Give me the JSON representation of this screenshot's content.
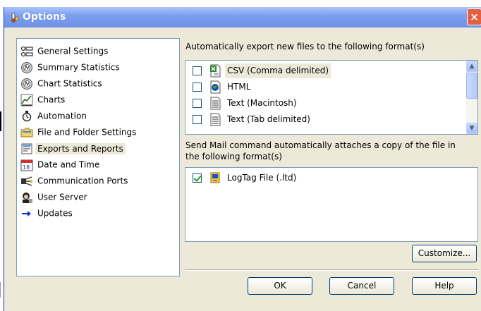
{
  "window": {
    "title": "Options",
    "close_glyph": "×"
  },
  "sidebar": {
    "items": [
      {
        "label": "General Settings",
        "icon": "general-settings-icon"
      },
      {
        "label": "Summary Statistics",
        "icon": "summary-statistics-icon"
      },
      {
        "label": "Chart Statistics",
        "icon": "chart-statistics-icon"
      },
      {
        "label": "Charts",
        "icon": "charts-icon"
      },
      {
        "label": "Automation",
        "icon": "automation-icon"
      },
      {
        "label": "File and Folder Settings",
        "icon": "folder-icon"
      },
      {
        "label": "Exports and Reports",
        "icon": "exports-icon",
        "selected": true
      },
      {
        "label": "Date and Time",
        "icon": "calendar-icon"
      },
      {
        "label": "Communication Ports",
        "icon": "ports-icon"
      },
      {
        "label": "User Server",
        "icon": "user-server-icon"
      },
      {
        "label": "Updates",
        "icon": "arrow-right-icon"
      }
    ]
  },
  "export": {
    "heading": "Automatically export new files to the following format(s)",
    "formats": [
      {
        "label": "CSV (Comma delimited)",
        "checked": false,
        "icon": "csv-file-icon"
      },
      {
        "label": "HTML",
        "checked": false,
        "icon": "html-file-icon"
      },
      {
        "label": "Text (Macintosh)",
        "checked": false,
        "icon": "text-file-icon"
      },
      {
        "label": "Text (Tab delimited)",
        "checked": false,
        "icon": "text-file-icon"
      }
    ]
  },
  "mail": {
    "heading_line1": "Send Mail command automatically attaches a copy of the file in",
    "heading_line2": "the following format(s)",
    "formats": [
      {
        "label": "LogTag File (.ltd)",
        "checked": true,
        "icon": "logtag-file-icon"
      }
    ]
  },
  "buttons": {
    "customize": "Customize...",
    "ok": "OK",
    "cancel": "Cancel",
    "help": "Help"
  },
  "colors": {
    "titlebar": "#7ea0f0",
    "dialog_bg": "#ece9d8",
    "close": "#e06040",
    "list_border": "#7f9db9"
  }
}
